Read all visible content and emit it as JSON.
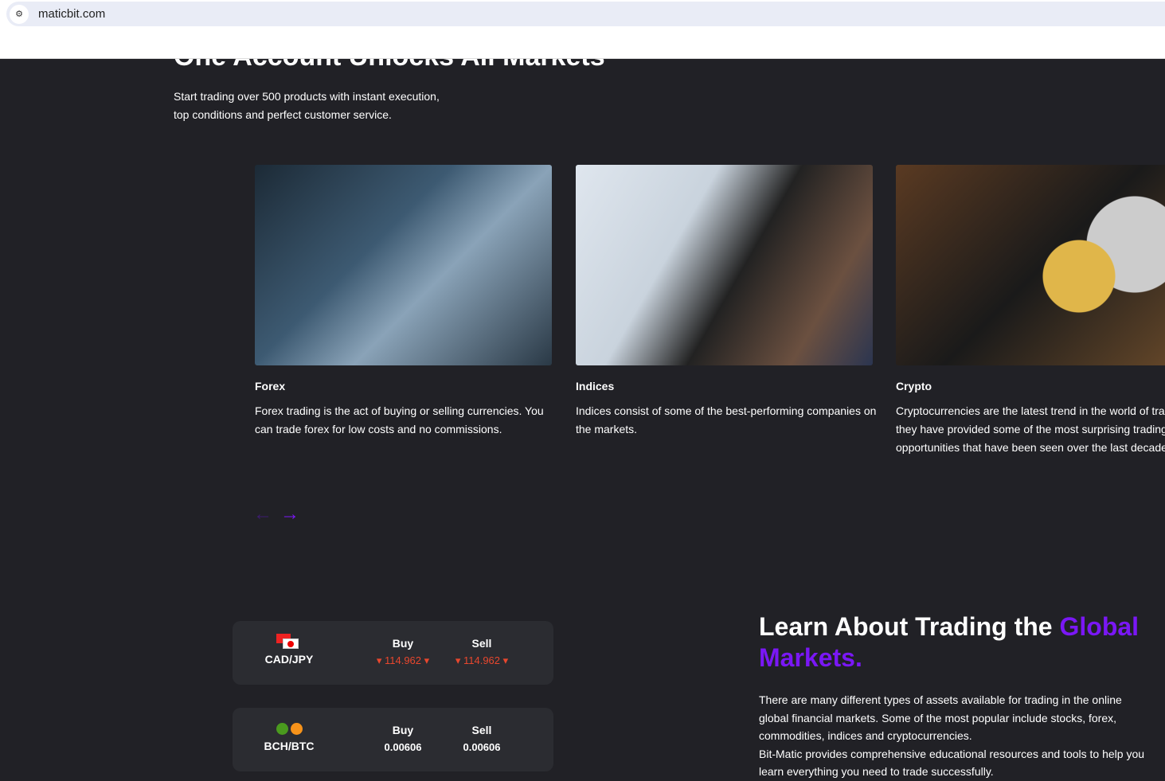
{
  "browser": {
    "url": "maticbit.com"
  },
  "hero": {
    "title": "One Account Unlocks All Markets",
    "subtitle_line1": "Start trading over 500 products with instant execution,",
    "subtitle_line2": "top conditions and perfect customer service."
  },
  "cards": [
    {
      "title": "Forex",
      "desc": "Forex trading is the act of buying or selling currencies. You can trade forex for low costs and no commissions."
    },
    {
      "title": "Indices",
      "desc": "Indices consist of some of the best-performing companies on the markets."
    },
    {
      "title": "Crypto",
      "desc": "Cryptocurrencies are the latest trend in the world of trading, they have provided some of the most surprising trading opportunities that have been seen over the last decade."
    }
  ],
  "carousel": {
    "prev": "←",
    "next": "→"
  },
  "tickers": [
    {
      "pair": "CAD/JPY",
      "buy_label": "Buy",
      "sell_label": "Sell",
      "buy": "114.962",
      "sell": "114.962"
    },
    {
      "pair": "BCH/BTC",
      "buy_label": "Buy",
      "sell_label": "Sell",
      "buy": "0.00606",
      "sell": "0.00606"
    }
  ],
  "learn": {
    "title_a": "Learn About Trading the ",
    "title_b": "Global Markets.",
    "p1": "There are many different types of assets available for trading in the online global financial markets. Some of the most popular include stocks, forex, commodities, indices and cryptocurrencies.",
    "p2": "Bit-Matic provides comprehensive educational resources and tools to help you learn everything you need to trade successfully."
  },
  "colors": {
    "accent": "#7a17f5",
    "down": "#e8472e",
    "bg": "#212126"
  }
}
